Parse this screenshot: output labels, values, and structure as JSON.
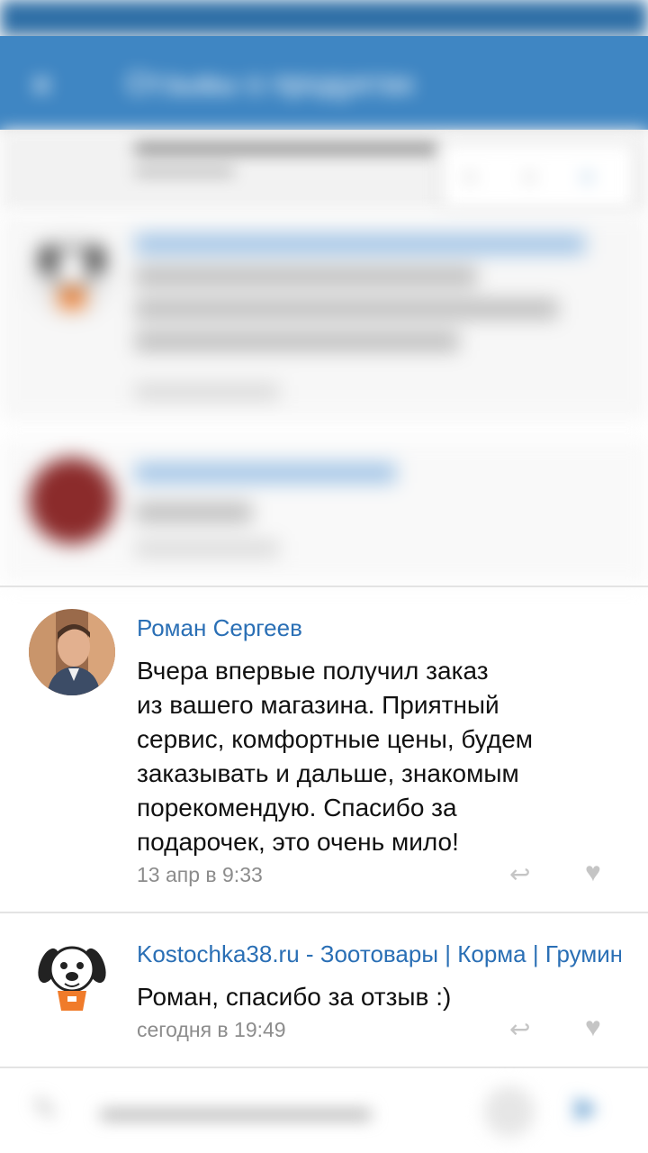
{
  "header": {
    "title": "Отзывы о продуктах",
    "back_icon": "close-icon"
  },
  "comments": [
    {
      "author": "Роман Сергеев",
      "text": "Вчера впервые получил заказ из вашего магазина. Приятный сервис, комфортные цены, будем заказывать и дальше, знакомым порекомендую. Спасибо за подарочек, это очень мило!",
      "lines": [
        "Вчера впервые получил заказ",
        "из вашего магазина. Приятный",
        "сервис, комфортные цены, будем",
        "заказывать и дальше, знакомым",
        "порекомендую. Спасибо за",
        "подарочек, это очень мило!"
      ],
      "date": "13 апр в 9:33"
    },
    {
      "author": "Kostochka38.ru - Зоотовары | Корма | Груминг",
      "text": "Роман, спасибо за отзыв :)",
      "date": "сегодня в 19:49"
    }
  ],
  "colors": {
    "accent": "#3f86c3",
    "author_link": "#2a6fb5",
    "date": "#8c8c8c"
  }
}
